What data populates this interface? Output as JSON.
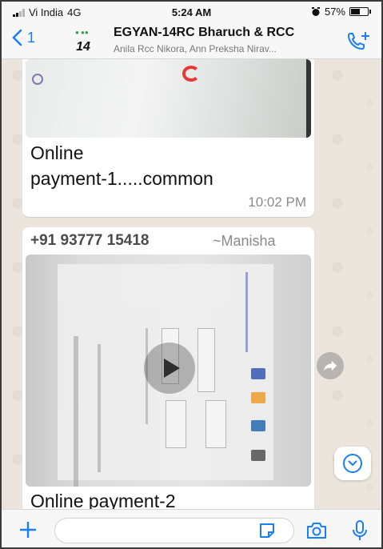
{
  "status_bar": {
    "carrier": "Vi India",
    "network": "4G",
    "time": "5:24 AM",
    "battery": "57%",
    "battery_level": 0.57
  },
  "header": {
    "back_count": "1",
    "avatar_text": "14",
    "title": "EGYAN-14RC Bharuch & RCC",
    "subtitle": "Anila Rcc Nikora, Ann Preksha Nirav..."
  },
  "messages": [
    {
      "caption_line1": "Online",
      "caption_line2": "payment-1.....common",
      "time": "10:02 PM"
    },
    {
      "sender_phone": "+91 93777 15418",
      "sender_name": "~Manisha",
      "caption": "Online payment-2"
    }
  ],
  "icons": {
    "back": "chevron-left-icon",
    "call": "add-call-icon",
    "forward": "forward-icon",
    "scroll_down": "chevron-down-icon",
    "plus": "plus-icon",
    "sticker": "sticker-icon",
    "camera": "camera-icon",
    "mic": "microphone-icon"
  },
  "colors": {
    "accent": "#1a7ef5",
    "chat_background": "#ece5dd",
    "bubble": "#ffffff"
  }
}
